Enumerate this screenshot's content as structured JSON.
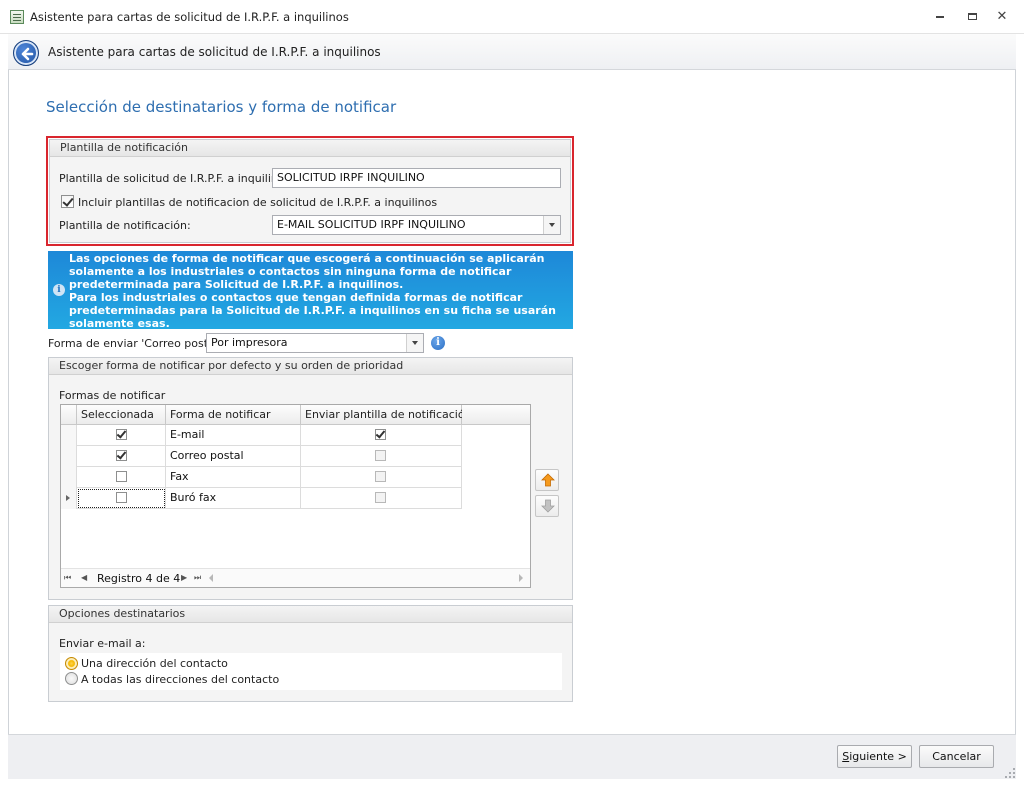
{
  "window": {
    "title": "Asistente para cartas de solicitud de I.R.P.F. a inquilinos",
    "controls": [
      "minimize",
      "maximize",
      "close"
    ]
  },
  "header": {
    "title": "Asistente para cartas de solicitud de I.R.P.F. a inquilinos",
    "back_icon": "back-arrow-icon"
  },
  "page": {
    "title": "Selección de destinatarios y forma de notificar"
  },
  "template_group": {
    "title": "Plantilla de notificación",
    "solicitud_label": "Plantilla de solicitud de I.R.P.F. a inquilinos:",
    "solicitud_value": "SOLICITUD IRPF INQUILINO",
    "include_checkbox_label": "Incluir plantillas de notificacion de solicitud de I.R.P.F. a inquilinos",
    "include_checked": true,
    "notificacion_label": "Plantilla de notificación:",
    "notificacion_value": "E-MAIL SOLICITUD IRPF INQUILINO"
  },
  "info_banner": {
    "line1": "Las opciones de forma de notificar que escogerá a continuación se aplicarán solamente a los industriales o contactos sin ninguna forma de notificar predeterminada para Solicitud de I.R.P.F. a inquilinos.",
    "line2": "Para los industriales o contactos que tengan definida formas de notificar predeterminadas para la Solicitud de I.R.P.F. a inquilinos en su ficha se usarán solamente esas."
  },
  "envio": {
    "label": "Forma de enviar 'Correo postal':",
    "value": "Por impresora"
  },
  "priority_group": {
    "title": "Escoger forma de notificar por defecto y su orden de prioridad",
    "grid_label": "Formas de notificar",
    "columns": [
      "Seleccionada",
      "Forma de notificar",
      "Enviar plantilla de notificación"
    ],
    "rows": [
      {
        "selected": true,
        "name": "E-mail",
        "send_template": true,
        "send_enabled": true
      },
      {
        "selected": true,
        "name": "Correo postal",
        "send_template": false,
        "send_enabled": false
      },
      {
        "selected": false,
        "name": "Fax",
        "send_template": false,
        "send_enabled": false
      },
      {
        "selected": false,
        "name": "Buró fax",
        "send_template": false,
        "send_enabled": false
      }
    ],
    "navigator_text": "Registro 4 de 4"
  },
  "options_group": {
    "title": "Opciones destinatarios",
    "enviar_label": "Enviar e-mail a:",
    "radio_options": [
      "Una dirección del contacto",
      "A todas las direcciones del contacto"
    ],
    "selected_index": 0
  },
  "footer": {
    "next_label_mnemonic": "S",
    "next_label_rest": "iguiente >",
    "cancel_label": "Cancelar"
  },
  "colors": {
    "accent_title": "#2e6eb0",
    "highlight_border": "#d9262e",
    "info_banner": "#1e88d8"
  }
}
